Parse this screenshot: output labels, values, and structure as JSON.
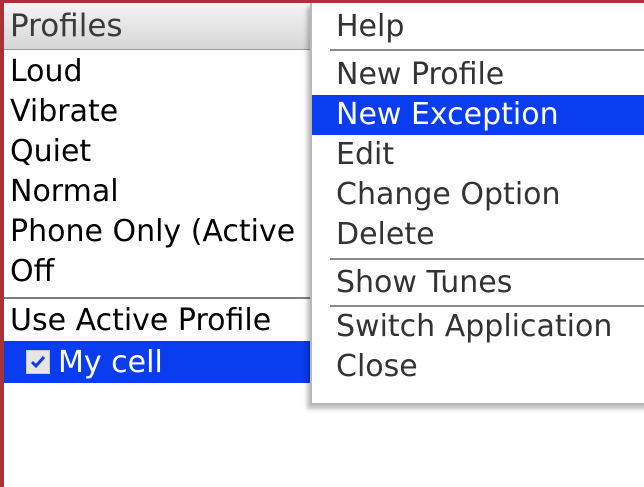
{
  "header": {
    "title": "Profiles"
  },
  "profiles": [
    "Loud",
    "Vibrate",
    "Quiet",
    "Normal",
    "Phone Only (Active",
    "Off"
  ],
  "use_active_profile": "Use Active Profile",
  "selected_item": {
    "label": "My cell",
    "checked": true
  },
  "menu": {
    "items": [
      "Help",
      "New Profile",
      "New Exception",
      "Edit",
      "Change Option",
      "Delete",
      "Show Tunes",
      "Switch Application",
      "Close"
    ],
    "selected": "New Exception"
  },
  "colors": {
    "highlight": "#0a3cf0",
    "frame": "#a8323c"
  }
}
